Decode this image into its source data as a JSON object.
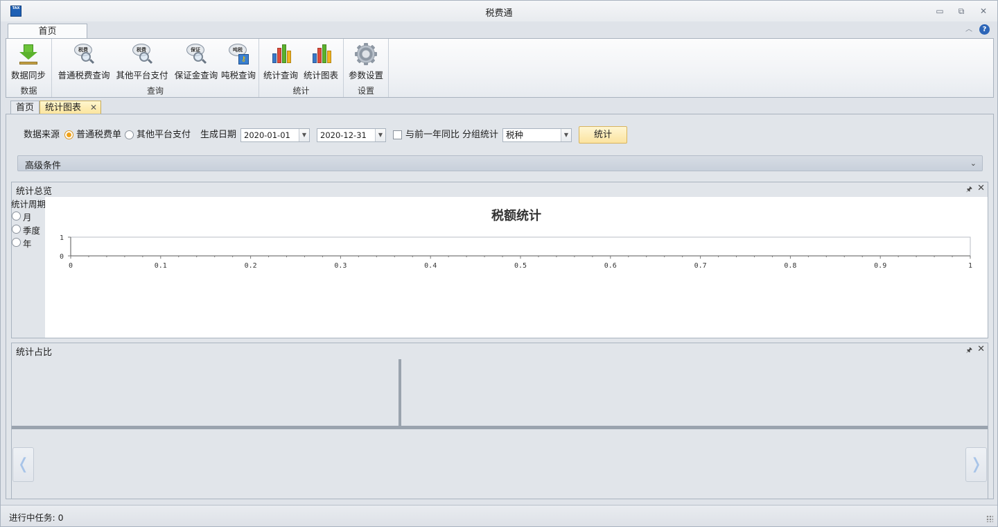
{
  "window": {
    "title": "税费通",
    "icon_text": "TAX",
    "minimize": "▭",
    "restore": "⧉",
    "close": "✕"
  },
  "ribbon": {
    "tab_label": "首页",
    "collapse": "︿",
    "help": "?",
    "groups": [
      {
        "label": "数据",
        "buttons": [
          {
            "label": "数据同步",
            "icon": "download-icon"
          }
        ]
      },
      {
        "label": "查询",
        "buttons": [
          {
            "label": "普通税费查询",
            "icon": "tax-query-icon",
            "bubble": "税费"
          },
          {
            "label": "其他平台支付",
            "icon": "tax-query-icon",
            "bubble": "税费"
          },
          {
            "label": "保证金查询",
            "icon": "deposit-query-icon",
            "bubble": "保证"
          },
          {
            "label": "吨税查询",
            "icon": "tonnage-tax-icon",
            "bubble": "吨税"
          }
        ]
      },
      {
        "label": "统计",
        "buttons": [
          {
            "label": "统计查询",
            "icon": "bar-chart-icon"
          },
          {
            "label": "统计图表",
            "icon": "bar-chart-icon"
          }
        ]
      },
      {
        "label": "设置",
        "buttons": [
          {
            "label": "参数设置",
            "icon": "gear-icon"
          }
        ]
      }
    ]
  },
  "doc_tabs": [
    {
      "label": "首页"
    },
    {
      "label": "统计图表",
      "close": "✕"
    }
  ],
  "filters": {
    "data_source_label": "数据来源",
    "source_options": [
      {
        "label": "普通税费单",
        "checked": true
      },
      {
        "label": "其他平台支付",
        "checked": false
      }
    ],
    "date_label": "生成日期",
    "date_from": "2020-01-01",
    "date_to": "2020-12-31",
    "yoy_label": "与前一年同比",
    "yoy_checked": false,
    "group_label": "分组统计",
    "group_value": "税种",
    "submit_label": "统计",
    "dropdown_arrow": "▼"
  },
  "advanced": {
    "label": "高级条件",
    "chevron": "⌄"
  },
  "overview_panel": {
    "title": "统计总览",
    "pin": "🖈",
    "close": "✕",
    "period_label": "统计周期",
    "period_options": [
      "月",
      "季度",
      "年"
    ]
  },
  "chart_data": {
    "type": "bar",
    "title": "税额统计",
    "xlabel": "",
    "ylabel": "",
    "x_ticks": [
      "0",
      "0.1",
      "0.2",
      "0.3",
      "0.4",
      "0.5",
      "0.6",
      "0.7",
      "0.8",
      "0.9",
      "1"
    ],
    "y_ticks": [
      "0",
      "1"
    ],
    "xlim": [
      0,
      1
    ],
    "ylim": [
      0,
      1
    ],
    "series": []
  },
  "ratio_panel": {
    "title": "统计占比",
    "pin": "🖈",
    "close": "✕",
    "nav_left": "❬",
    "nav_right": "❭"
  },
  "status": {
    "text": "进行中任务: 0"
  },
  "colors": {
    "accent": "#f0a21a",
    "active_tab": "#fbe49b",
    "button_gold": "#fbe3a0"
  }
}
